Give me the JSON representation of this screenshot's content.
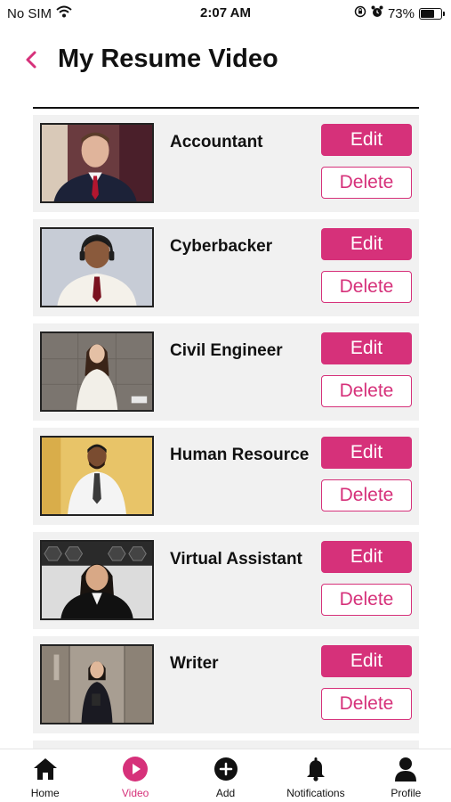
{
  "status_bar": {
    "carrier": "No SIM",
    "time": "2:07 AM",
    "battery": "73%",
    "battery_level": 0.73
  },
  "header": {
    "title": "My Resume Video",
    "back_icon": "chevron-left-icon"
  },
  "colors": {
    "accent": "#d6317a",
    "card_bg": "#f1f1f1"
  },
  "videos": [
    {
      "title": "Accountant",
      "edit_label": "Edit",
      "delete_label": "Delete"
    },
    {
      "title": "Cyberbacker",
      "edit_label": "Edit",
      "delete_label": "Delete"
    },
    {
      "title": "Civil Engineer",
      "edit_label": "Edit",
      "delete_label": "Delete"
    },
    {
      "title": "Human Resource",
      "edit_label": "Edit",
      "delete_label": "Delete"
    },
    {
      "title": "Virtual Assistant",
      "edit_label": "Edit",
      "delete_label": "Delete"
    },
    {
      "title": "Writer",
      "edit_label": "Edit",
      "delete_label": "Delete"
    }
  ],
  "bottom_nav": [
    {
      "label": "Home",
      "icon": "home-icon",
      "active": false
    },
    {
      "label": "Video",
      "icon": "play-icon",
      "active": true
    },
    {
      "label": "Add",
      "icon": "add-icon",
      "active": false
    },
    {
      "label": "Notifications",
      "icon": "bell-icon",
      "active": false
    },
    {
      "label": "Profile",
      "icon": "profile-icon",
      "active": false
    }
  ]
}
